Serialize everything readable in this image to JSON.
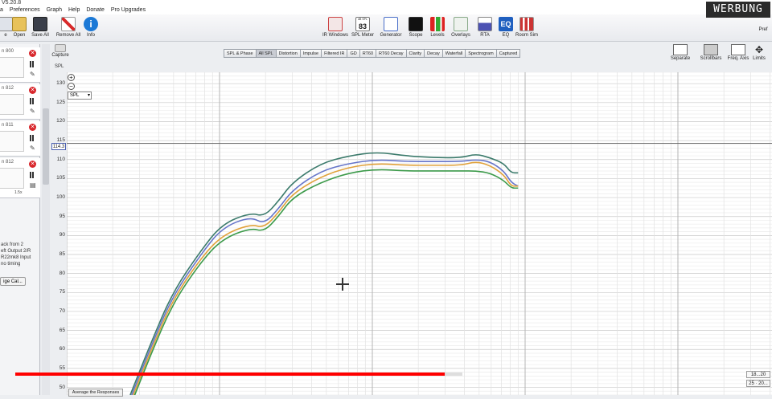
{
  "window": {
    "title": "V5.20.8"
  },
  "menu": [
    "a",
    "Preferences",
    "Graph",
    "Help",
    "Donate",
    "Pro Upgrades"
  ],
  "toolbar_left": [
    {
      "label": "e",
      "icon": "file-icon"
    },
    {
      "label": "Open",
      "icon": "folder-open-icon"
    },
    {
      "label": "Save All",
      "icon": "save-icon"
    },
    {
      "label": "Remove All",
      "icon": "remove-all-icon"
    },
    {
      "label": "Info",
      "icon": "info-icon"
    }
  ],
  "toolbar_center": [
    {
      "label": "IR Windows",
      "icon": "ir-windows-icon"
    },
    {
      "label": "SPL Meter",
      "icon": "spl-meter-icon",
      "display": "83",
      "display_unit": "dB SPL"
    },
    {
      "label": "Generator",
      "icon": "generator-icon"
    },
    {
      "label": "Scope",
      "icon": "scope-icon"
    },
    {
      "label": "Levels",
      "icon": "levels-icon"
    },
    {
      "label": "Overlays",
      "icon": "overlays-icon"
    },
    {
      "label": "RTA",
      "icon": "rta-icon"
    },
    {
      "label": "EQ",
      "icon": "eq-icon"
    },
    {
      "label": "Room Sim",
      "icon": "room-sim-icon"
    }
  ],
  "toolbar_right_label": "Pref",
  "ad_badge": "WERBUNG",
  "measurements": [
    {
      "label": "n 800",
      "curve_color": "#e0a13a"
    },
    {
      "label": "n 812",
      "curve_color": "#2e8b57"
    },
    {
      "label": "n 811",
      "curve_color": "#e0a13a"
    },
    {
      "label": "n 812",
      "curve_color": "#6a5acd"
    }
  ],
  "meas_value": "1.5x",
  "notes": [
    "ack from 2",
    "eft Output 2/R",
    "R22mk8 Input",
    "no timing"
  ],
  "gecal_label": "ige Cal...",
  "capture": {
    "label": "Capture"
  },
  "panel_label": "SPL",
  "tabs": [
    {
      "label": "SPL & Phase",
      "active": false
    },
    {
      "label": "All SPL",
      "active": true
    },
    {
      "label": "Distortion",
      "active": false
    },
    {
      "label": "Impulse",
      "active": false
    },
    {
      "label": "Filtered IR",
      "active": false
    },
    {
      "label": "GD",
      "active": false
    },
    {
      "label": "RT60",
      "active": false
    },
    {
      "label": "RT60 Decay",
      "active": false
    },
    {
      "label": "Clarity",
      "active": false
    },
    {
      "label": "Decay",
      "active": false
    },
    {
      "label": "Waterfall",
      "active": false
    },
    {
      "label": "Spectrogram",
      "active": false
    },
    {
      "label": "Captured",
      "active": false
    }
  ],
  "right_tools": [
    {
      "label": "Separate",
      "icon": "separate-icon"
    },
    {
      "label": "Scrollbars",
      "icon": "scrollbars-icon"
    },
    {
      "label": "Freq. Axis",
      "icon": "freq-axis-icon"
    },
    {
      "label": "Limits",
      "icon": "limits-icon"
    }
  ],
  "graph": {
    "zoom_in": "+",
    "zoom_out": "−",
    "unit_select": "SPL",
    "cursor_value": "114.3",
    "y_ticks": [
      "130",
      "125",
      "120",
      "115",
      "110",
      "105",
      "100",
      "95",
      "90",
      "85",
      "80",
      "75",
      "70",
      "65",
      "60",
      "55",
      "50"
    ],
    "average_button": "Average the Responses",
    "freq_selects": [
      "18...20",
      "25 · 20..."
    ]
  },
  "chart_data": {
    "type": "line",
    "ylim": [
      48,
      133
    ],
    "y_ticks": [
      130,
      125,
      120,
      115,
      110,
      105,
      100,
      95,
      90,
      85,
      80,
      75,
      70,
      65,
      60,
      55,
      50
    ],
    "cursor_y": 114.3,
    "x_norm": [
      0.09,
      0.12,
      0.15,
      0.19,
      0.22,
      0.26,
      0.28,
      0.3,
      0.32,
      0.36,
      0.4,
      0.44,
      0.48,
      0.52,
      0.56,
      0.58,
      0.6,
      0.62,
      0.63,
      0.64
    ],
    "series": [
      {
        "color": "#3b7a6b",
        "values": [
          48,
          62,
          75,
          86,
          93,
          96,
          95,
          99,
          104,
          109,
          111,
          112,
          111,
          110.5,
          110.5,
          111.5,
          110.5,
          109,
          106.5,
          106.5
        ]
      },
      {
        "color": "#6675c9",
        "values": [
          47,
          61,
          74,
          85,
          92,
          95,
          93,
          97,
          102,
          107,
          109,
          110,
          109.5,
          109.5,
          109.5,
          110,
          109.5,
          107,
          104,
          103
        ]
      },
      {
        "color": "#e0a13a",
        "values": [
          46,
          60,
          73,
          84,
          90,
          93,
          92,
          96,
          101,
          105.5,
          108,
          109,
          108.5,
          108.5,
          108.5,
          109.5,
          108.5,
          106,
          103,
          103
        ]
      },
      {
        "color": "#3c9a4a",
        "values": [
          45,
          59,
          72,
          83,
          89,
          92,
          91,
          95,
          100,
          104,
          106.5,
          107.5,
          107,
          107,
          107,
          107,
          106.5,
          104.5,
          102.5,
          102.5
        ]
      }
    ]
  },
  "video_progress": 0.96
}
